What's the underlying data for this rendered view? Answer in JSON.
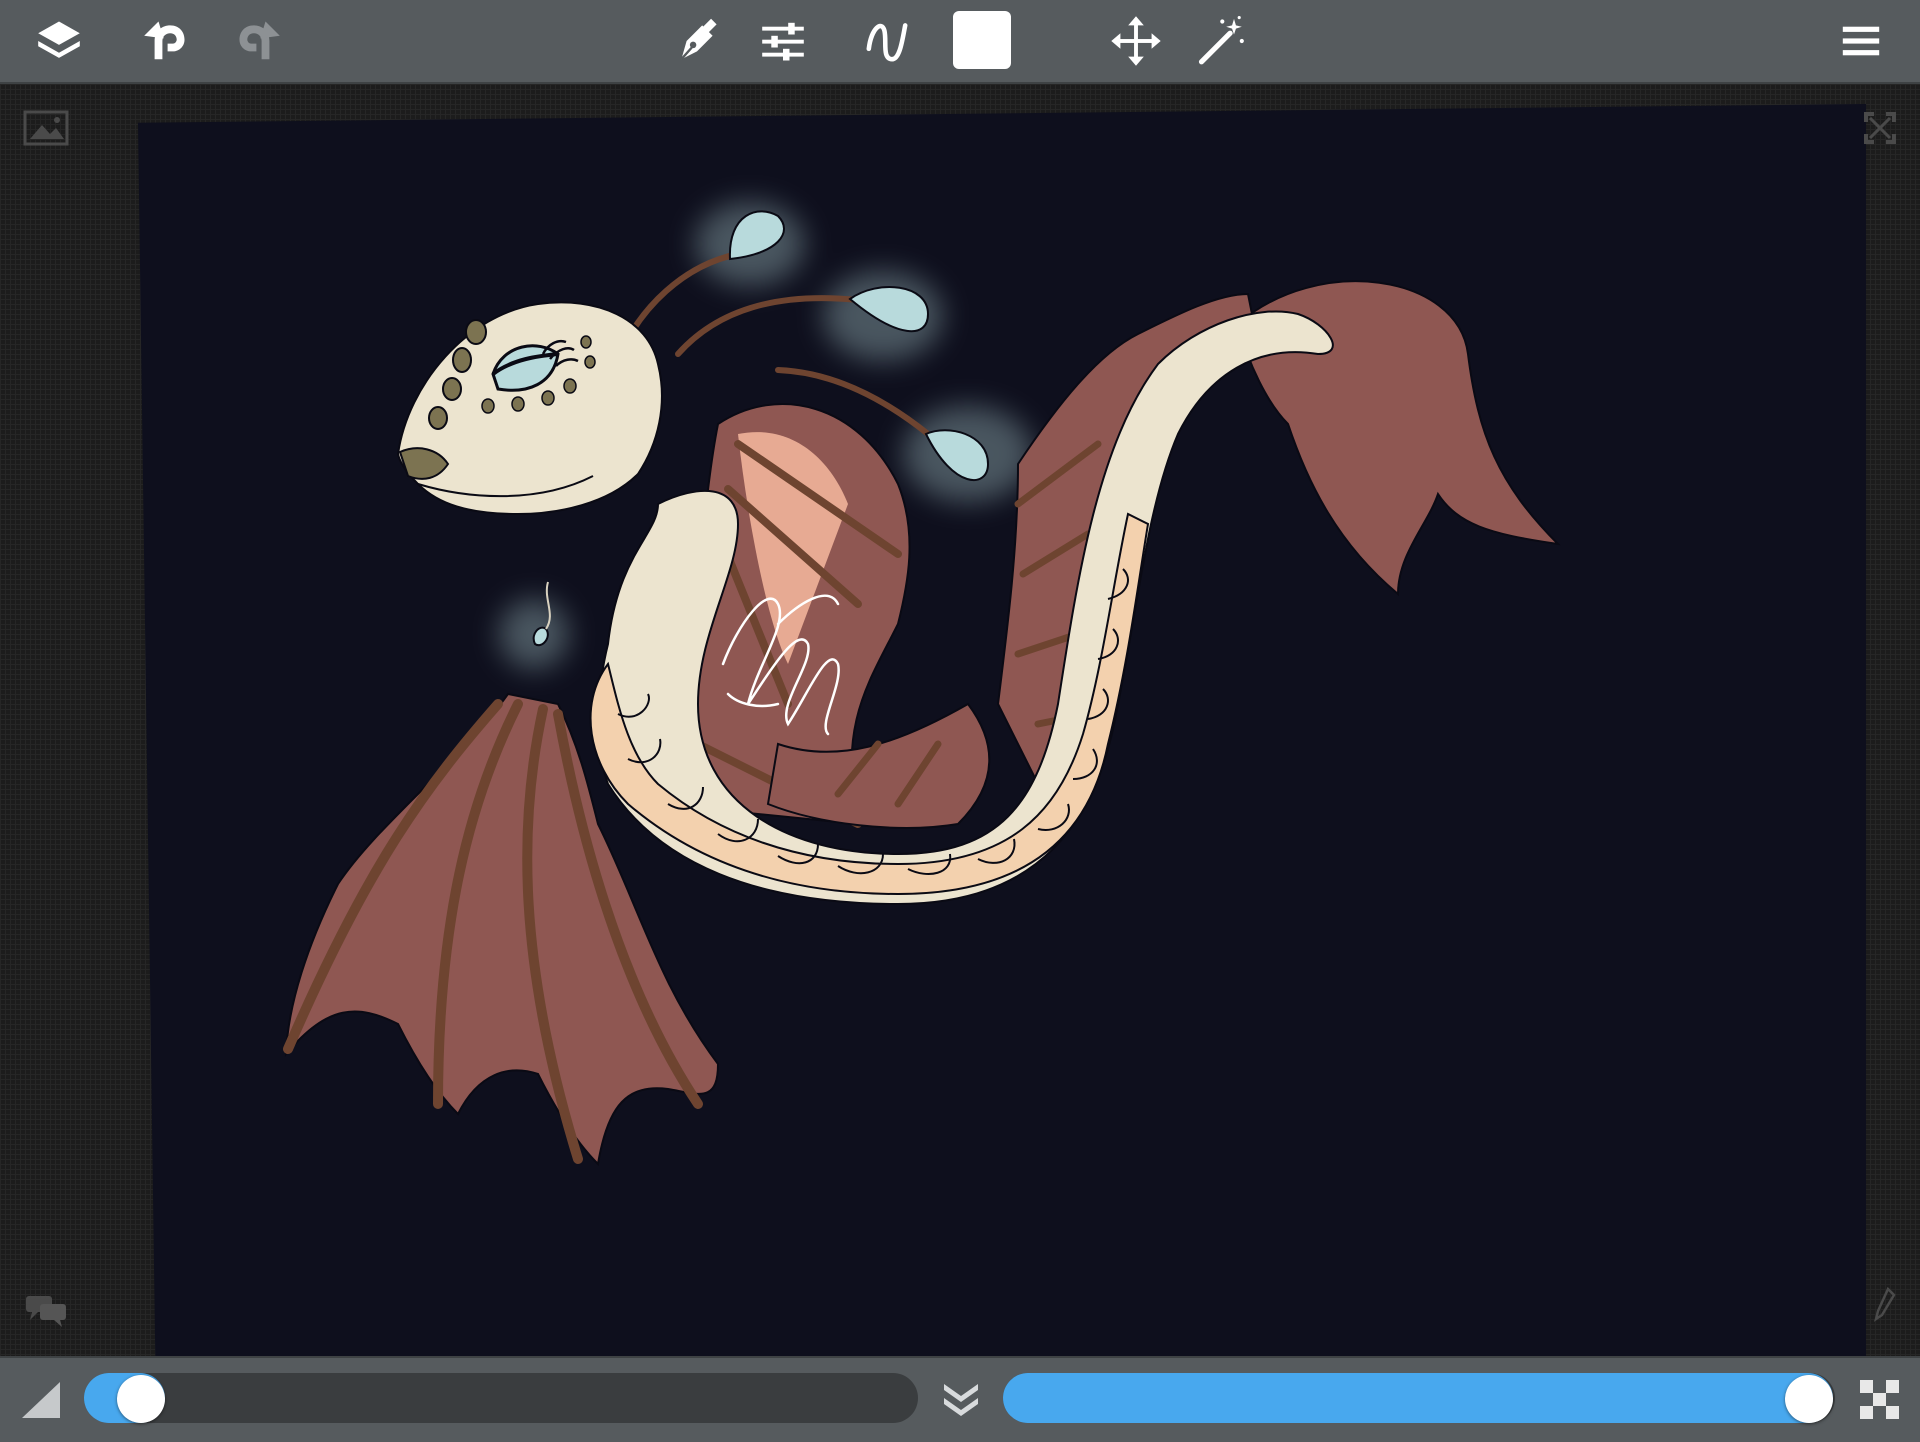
{
  "toolbar": {
    "buttons": [
      {
        "name": "layers",
        "icon": "layers-icon"
      },
      {
        "name": "undo",
        "icon": "undo-icon"
      },
      {
        "name": "redo",
        "icon": "redo-icon",
        "disabled": true
      },
      {
        "name": "brush",
        "icon": "pen-nib-icon"
      },
      {
        "name": "brush-settings",
        "icon": "sliders-icon"
      },
      {
        "name": "stroke-stabilizer",
        "icon": "curve-icon"
      },
      {
        "name": "color-swatch",
        "icon": "color-swatch",
        "color": "#ffffff"
      },
      {
        "name": "transform",
        "icon": "move-arrows-icon"
      },
      {
        "name": "magic-wand",
        "icon": "magic-wand-icon"
      },
      {
        "name": "menu",
        "icon": "hamburger-menu-icon"
      }
    ],
    "current_color": "#ffffff"
  },
  "sliders": {
    "brush_size_fraction": 0.04,
    "opacity_fraction": 1.0
  },
  "colors": {
    "toolbar_bg": "#565b5e",
    "accent_blue": "#48a8ee",
    "canvas_bg": "#0e0f1d",
    "dragon_body": "#ece4cf",
    "dragon_belly": "#f3d1ae",
    "dragon_fins": "#8f5752",
    "fin_ribs": "#6e4430",
    "glow_blue": "#b8dadc"
  }
}
